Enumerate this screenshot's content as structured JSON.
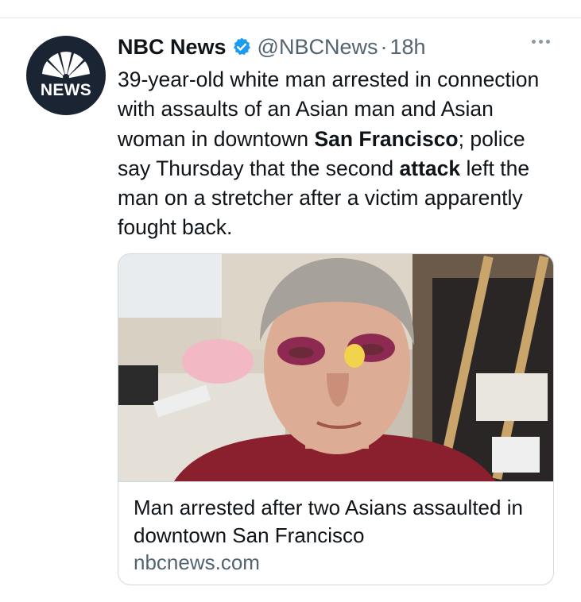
{
  "tweet": {
    "author": "NBC News",
    "handle": "@NBCNews",
    "separator": "·",
    "time": "18h",
    "avatar_text": "NEWS",
    "segments": [
      "39-year-old white man arrested in connection with assaults of an Asian man and Asian woman in downtown ",
      "San Francisco",
      "; police say Thursday that the second ",
      "attack",
      " left the man on a stretcher after a victim apparently fought back."
    ]
  },
  "card": {
    "title": "Man arrested after two Asians assaulted in downtown San Francisco",
    "domain": "nbcnews.com"
  },
  "icons": {
    "avatar": "nbc-peacock-logo",
    "verified": "verified-badge-icon",
    "more": "more-options-icon"
  },
  "colors": {
    "verified": "#1d9bf0",
    "secondary_text": "#536471",
    "avatar_bg": "#1b2433"
  }
}
